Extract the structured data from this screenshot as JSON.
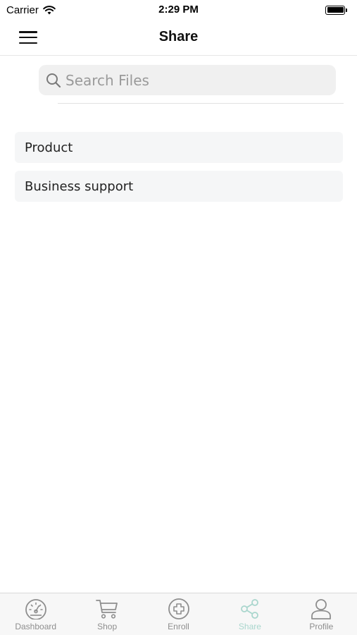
{
  "status_bar": {
    "carrier": "Carrier",
    "time": "2:29 PM"
  },
  "nav": {
    "title": "Share"
  },
  "search": {
    "placeholder": "Search Files",
    "value": ""
  },
  "list": {
    "items": [
      {
        "label": "Product"
      },
      {
        "label": "Business support"
      }
    ]
  },
  "tab_bar": {
    "tabs": [
      {
        "label": "Dashboard",
        "icon": "dashboard-gauge-icon"
      },
      {
        "label": "Shop",
        "icon": "cart-icon"
      },
      {
        "label": "Enroll",
        "icon": "plus-circle-icon"
      },
      {
        "label": "Share",
        "icon": "share-icon",
        "active": true
      },
      {
        "label": "Profile",
        "icon": "person-icon"
      }
    ],
    "inactive_color": "#8e8e8e",
    "active_color": "#a9d6cd"
  }
}
